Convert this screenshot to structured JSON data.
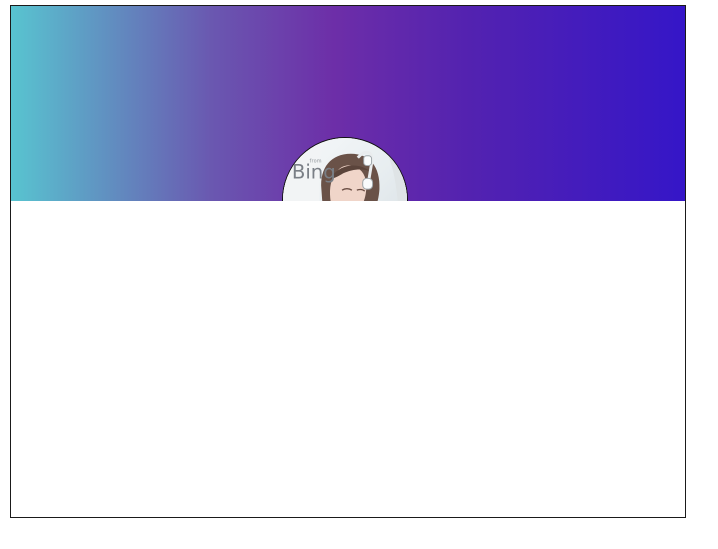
{
  "profile": {
    "avatar_image_text": "Bing",
    "avatar_image_subtext": "from"
  },
  "colors": {
    "banner_left": "#58c4d0",
    "banner_middle": "#6d2ea8",
    "banner_right": "#3516c8",
    "background": "#ffffff",
    "frame_border": "#1a1a1a"
  }
}
